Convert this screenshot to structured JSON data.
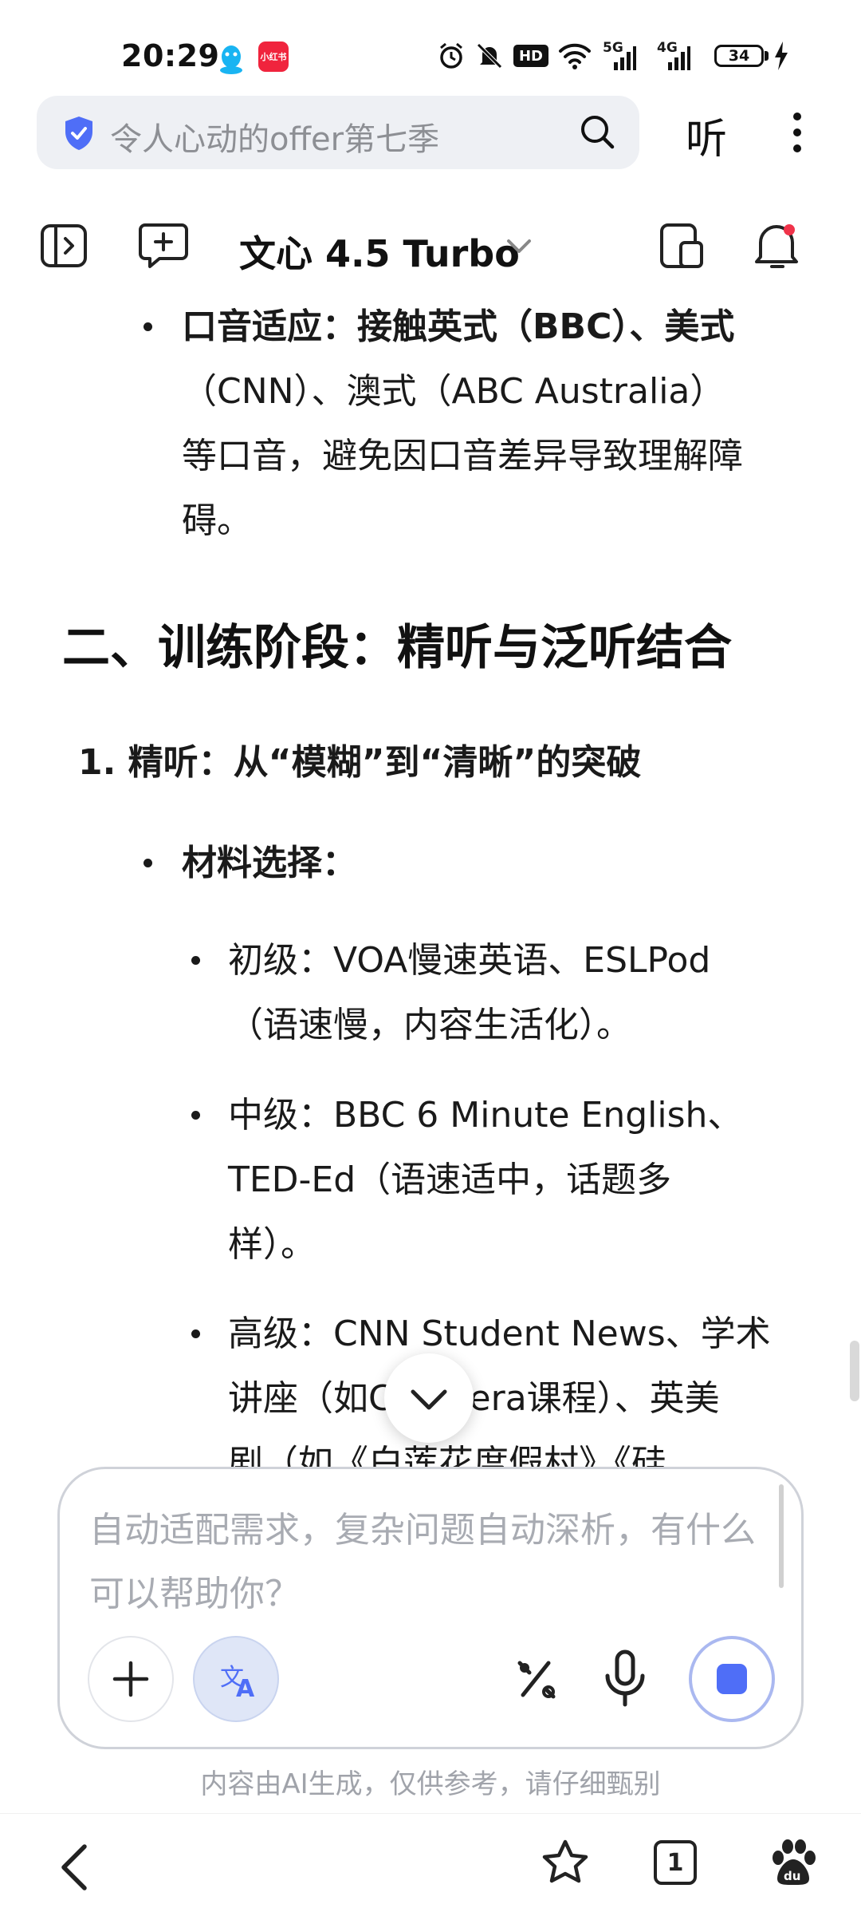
{
  "status_bar": {
    "time": "20:29",
    "app_badge": "小红书",
    "network_5g": "5G",
    "network_4g": "4G",
    "hd_label": "HD",
    "battery": "34"
  },
  "search": {
    "query": "令人心动的offer第七季",
    "listen_label": "听"
  },
  "toolbar": {
    "model_name": "文心 4.5 Turbo"
  },
  "content": {
    "accent_lines": [
      "口音适应：接触英式（BBC）、美式",
      "（CNN）、澳式（ABC Australia）",
      "等口音，避免因口音差异导致理解障",
      "碍。"
    ],
    "section_heading": "二、训练阶段：精听与泛听结合",
    "sub_item": "1. 精听：从“模糊”到“清晰”的突破",
    "material_label": "材料选择：",
    "beginner_lines": [
      "初级：VOA慢速英语、ESLPod",
      "（语速慢，内容生活化）。"
    ],
    "intermediate_lines": [
      "中级：BBC 6 Minute English、",
      "TED-Ed（语速适中，话题多",
      "样）。"
    ],
    "advanced_lines": [
      "高级：CNN Student News、学术",
      "讲座（如Coursera课程）、英美",
      "剧（如《白莲花度假村》《硅"
    ]
  },
  "composer": {
    "placeholder": "自动适配需求，复杂问题自动深析，有什么可以帮助你？"
  },
  "disclaimer": "内容由AI生成，仅供参考，请仔细甄别",
  "bottom_nav": {
    "tab_count": "1"
  },
  "colors": {
    "accent": "#4f6ef7",
    "search_bg": "#eef0f4",
    "badge_red": "#f0243d",
    "notification_dot": "#f0334a"
  }
}
